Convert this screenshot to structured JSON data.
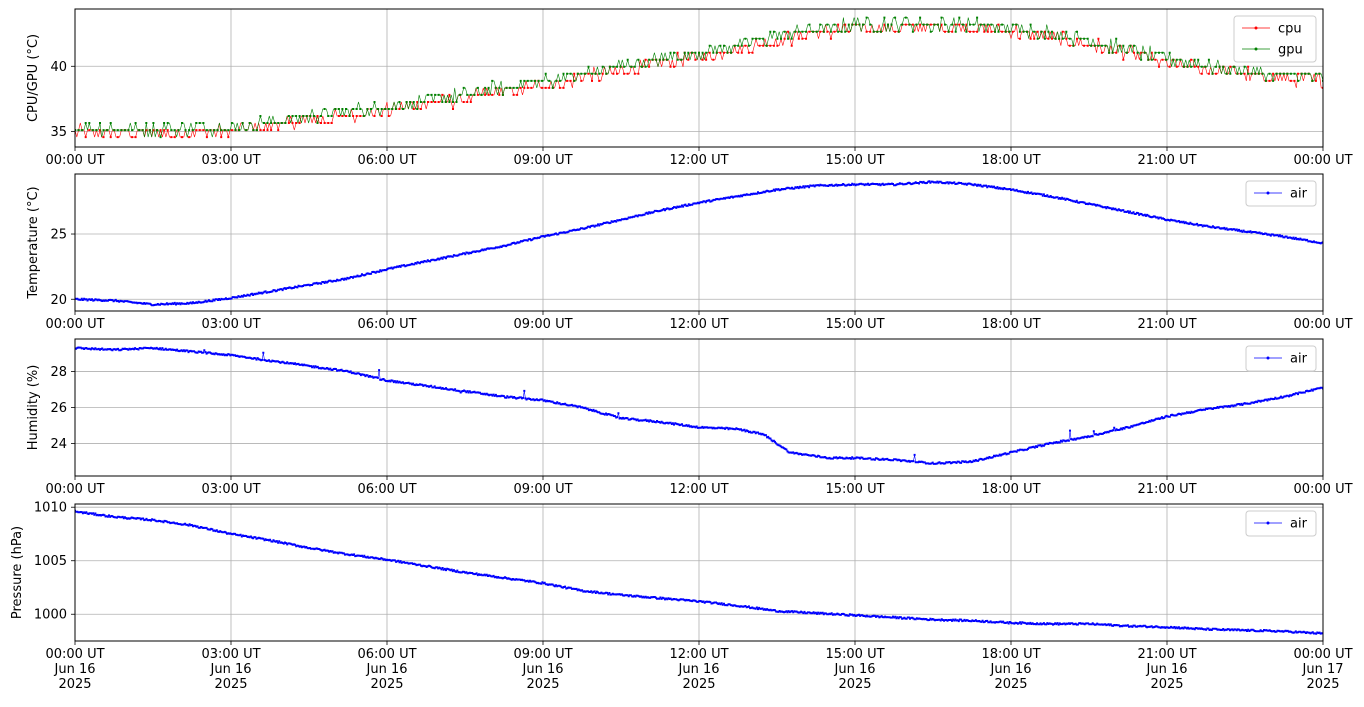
{
  "chart_data": [
    {
      "type": "line",
      "ylabel": "CPU/GPU (°C)",
      "xlim": [
        "2025-06-16 00:00",
        "2025-06-17 00:00"
      ],
      "ylim": [
        33.8,
        44.4
      ],
      "yticks": [
        35,
        40
      ],
      "xtick_labels": [
        "00:00 UT",
        "03:00 UT",
        "06:00 UT",
        "09:00 UT",
        "12:00 UT",
        "15:00 UT",
        "18:00 UT",
        "21:00 UT",
        "00:00 UT"
      ],
      "grid": true,
      "legend": "top-right",
      "series": [
        {
          "name": "cpu",
          "color": "#ff0000",
          "x_hours": [
            0,
            1,
            2,
            3,
            4,
            5,
            6,
            7,
            8,
            9,
            10,
            11,
            12,
            13,
            14,
            15,
            16,
            17,
            18,
            19,
            20,
            21,
            22,
            23,
            24
          ],
          "values": [
            35.0,
            34.9,
            34.9,
            35.0,
            35.6,
            36.1,
            36.6,
            37.2,
            37.9,
            38.5,
            39.3,
            40.0,
            40.7,
            41.5,
            42.4,
            42.9,
            43.0,
            43.0,
            42.7,
            42.1,
            41.2,
            40.3,
            39.6,
            39.1,
            38.9
          ]
        },
        {
          "name": "gpu",
          "color": "#008000",
          "x_hours": [
            0,
            1,
            2,
            3,
            4,
            5,
            6,
            7,
            8,
            9,
            10,
            11,
            12,
            13,
            14,
            15,
            16,
            17,
            18,
            19,
            20,
            21,
            22,
            23,
            24
          ],
          "values": [
            35.3,
            35.2,
            35.2,
            35.3,
            35.9,
            36.4,
            36.9,
            37.5,
            38.2,
            38.8,
            39.6,
            40.4,
            41.0,
            41.9,
            42.7,
            43.2,
            43.3,
            43.2,
            43.0,
            42.4,
            41.5,
            40.6,
            39.9,
            39.4,
            39.1
          ]
        }
      ]
    },
    {
      "type": "line",
      "ylabel": "Temperature (°C)",
      "xlim": [
        "2025-06-16 00:00",
        "2025-06-17 00:00"
      ],
      "ylim": [
        19.1,
        29.6
      ],
      "yticks": [
        20,
        25
      ],
      "xtick_labels": [
        "00:00 UT",
        "03:00 UT",
        "06:00 UT",
        "09:00 UT",
        "12:00 UT",
        "15:00 UT",
        "18:00 UT",
        "21:00 UT",
        "00:00 UT"
      ],
      "grid": true,
      "legend": "top-right",
      "series": [
        {
          "name": "air",
          "color": "#0000ff",
          "x_hours": [
            0,
            0.75,
            1.5,
            2.25,
            3,
            3.75,
            4.5,
            5.25,
            6,
            6.75,
            7.5,
            8.25,
            9,
            9.75,
            10.5,
            11.25,
            12,
            12.75,
            13.5,
            14.25,
            15,
            15.75,
            16.5,
            17.25,
            18,
            18.75,
            19.5,
            20.25,
            21,
            21.75,
            22.5,
            23.25,
            24
          ],
          "values": [
            20.0,
            19.9,
            19.6,
            19.7,
            20.1,
            20.6,
            21.1,
            21.6,
            22.3,
            22.9,
            23.5,
            24.1,
            24.8,
            25.4,
            26.1,
            26.8,
            27.4,
            27.9,
            28.4,
            28.7,
            28.8,
            28.8,
            29.0,
            28.8,
            28.4,
            27.9,
            27.3,
            26.7,
            26.1,
            25.6,
            25.2,
            24.8,
            24.3
          ]
        }
      ]
    },
    {
      "type": "line",
      "ylabel": "Humidity (%)",
      "xlim": [
        "2025-06-16 00:00",
        "2025-06-17 00:00"
      ],
      "ylim": [
        22.2,
        29.8
      ],
      "yticks": [
        24,
        26,
        28
      ],
      "xtick_labels": [
        "00:00 UT",
        "03:00 UT",
        "06:00 UT",
        "09:00 UT",
        "12:00 UT",
        "15:00 UT",
        "18:00 UT",
        "21:00 UT",
        "00:00 UT"
      ],
      "grid": true,
      "legend": "top-right",
      "series": [
        {
          "name": "air",
          "color": "#0000ff",
          "x_hours": [
            0,
            0.75,
            1.5,
            2.25,
            3,
            3.75,
            4.5,
            5.25,
            6,
            6.75,
            7.5,
            8.25,
            9,
            9.75,
            10.5,
            11.25,
            12,
            12.75,
            13.25,
            13.75,
            14.5,
            15,
            15.75,
            16.5,
            17.25,
            18,
            18.75,
            19.5,
            20.25,
            21,
            21.75,
            22.5,
            23.25,
            24
          ],
          "values": [
            29.3,
            29.2,
            29.3,
            29.1,
            28.9,
            28.6,
            28.3,
            28.0,
            27.5,
            27.2,
            26.9,
            26.6,
            26.4,
            26.0,
            25.4,
            25.2,
            24.9,
            24.8,
            24.5,
            23.5,
            23.2,
            23.2,
            23.1,
            22.9,
            23.0,
            23.5,
            24.0,
            24.4,
            24.9,
            25.5,
            25.9,
            26.2,
            26.6,
            27.1
          ]
        }
      ]
    },
    {
      "type": "line",
      "ylabel": "Pressure (hPa)",
      "xlim": [
        "2025-06-16 00:00",
        "2025-06-17 00:00"
      ],
      "ylim": [
        997.5,
        1010.3
      ],
      "yticks": [
        1000,
        1005,
        1010
      ],
      "xtick_labels": [
        [
          "00:00 UT",
          "Jun 16",
          "2025"
        ],
        [
          "03:00 UT",
          "Jun 16",
          "2025"
        ],
        [
          "06:00 UT",
          "Jun 16",
          "2025"
        ],
        [
          "09:00 UT",
          "Jun 16",
          "2025"
        ],
        [
          "12:00 UT",
          "Jun 16",
          "2025"
        ],
        [
          "15:00 UT",
          "Jun 16",
          "2025"
        ],
        [
          "18:00 UT",
          "Jun 16",
          "2025"
        ],
        [
          "21:00 UT",
          "Jun 16",
          "2025"
        ],
        [
          "00:00 UT",
          "Jun 17",
          "2025"
        ]
      ],
      "grid": true,
      "legend": "top-right",
      "series": [
        {
          "name": "air",
          "color": "#0000ff",
          "x_hours": [
            0,
            0.75,
            1.5,
            2.25,
            3,
            3.75,
            4.5,
            5.25,
            6,
            6.75,
            7.5,
            8.25,
            9,
            9.75,
            10.5,
            11.25,
            12,
            12.75,
            13.5,
            14.25,
            15,
            15.75,
            16.5,
            17.25,
            18,
            18.75,
            19.5,
            20.25,
            21,
            21.75,
            22.5,
            23.25,
            24
          ],
          "values": [
            1009.6,
            1009.1,
            1008.8,
            1008.3,
            1007.5,
            1006.9,
            1006.2,
            1005.6,
            1005.1,
            1004.5,
            1003.9,
            1003.4,
            1002.9,
            1002.2,
            1001.8,
            1001.5,
            1001.2,
            1000.8,
            1000.3,
            1000.1,
            999.9,
            999.7,
            999.5,
            999.4,
            999.2,
            999.1,
            999.1,
            998.9,
            998.8,
            998.6,
            998.5,
            998.4,
            998.2
          ]
        }
      ]
    }
  ]
}
